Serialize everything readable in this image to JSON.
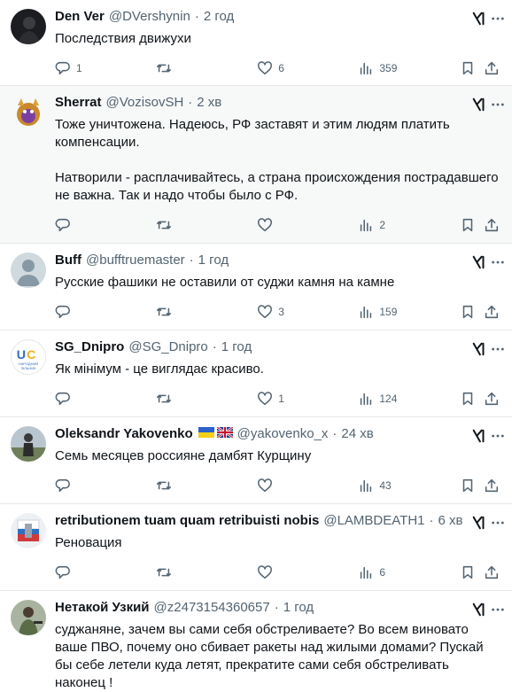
{
  "tweets": [
    {
      "name": "Den Ver",
      "handle": "@DVershynin",
      "time": "2 год",
      "text": "Последствия движухи",
      "replies": "1",
      "retweets": "",
      "likes": "6",
      "views": "359",
      "highlight": false
    },
    {
      "name": "Sherrat",
      "handle": "@VozisovSH",
      "time": "2 хв",
      "text": "Тоже уничтожена. Надеюсь, РФ заставят и этим людям платить компенсации.\n\nНатворили - расплачивайтесь, а страна происхождения пострадавшего не важна. Так и надо чтобы было с РФ.",
      "replies": "",
      "retweets": "",
      "likes": "",
      "views": "2",
      "highlight": true
    },
    {
      "name": "Buff",
      "handle": "@bufftruemaster",
      "time": "1 год",
      "text": "Русские фашики не оставили от суджи камня на камне",
      "replies": "",
      "retweets": "",
      "likes": "3",
      "views": "159",
      "highlight": false
    },
    {
      "name": "SG_Dnipro",
      "handle": "@SG_Dnipro",
      "time": "1 год",
      "text": "Як мінімум - це виглядає красиво.",
      "replies": "",
      "retweets": "",
      "likes": "1",
      "views": "124",
      "highlight": false,
      "avatar_text": "НАРОДНИЙ ЗІЛЬНИК"
    },
    {
      "name": "Oleksandr Yakovenko",
      "handle": "@yakovenko_x",
      "time": "24 хв",
      "text": "Семь месяцев россияне дамбят Курщину",
      "replies": "",
      "retweets": "",
      "likes": "",
      "views": "43",
      "highlight": false
    },
    {
      "name": "retributionem tuam quam retribuisti nobis",
      "handle": "@LAMBDEATH1",
      "time": "6 хв",
      "text": "Реновация",
      "replies": "",
      "retweets": "",
      "likes": "",
      "views": "6",
      "highlight": false
    },
    {
      "name": "Нетакой Узкий",
      "handle": "@z2473154360657",
      "time": "1 год",
      "text": "суджаняне, зачем вы сами себя обстреливаете? Во всем виновато ваше ПВО, почему оно сбивает ракеты над жилыми домами? Пускай бы себе летели куда летят, прекратите сами себя обстреливать наконец !",
      "replies": "",
      "retweets": "",
      "likes": "",
      "views": "",
      "highlight": false
    }
  ],
  "icons": {
    "reply": "reply-icon",
    "retweet": "retweet-icon",
    "like": "like-icon",
    "views": "views-icon",
    "bookmark": "bookmark-icon",
    "share": "share-icon",
    "grok": "grok-icon"
  },
  "colors": {
    "text": "#0f1419",
    "secondary": "#536471",
    "highlight_bg": "#f7f8f8",
    "border": "#e4e7ea"
  }
}
